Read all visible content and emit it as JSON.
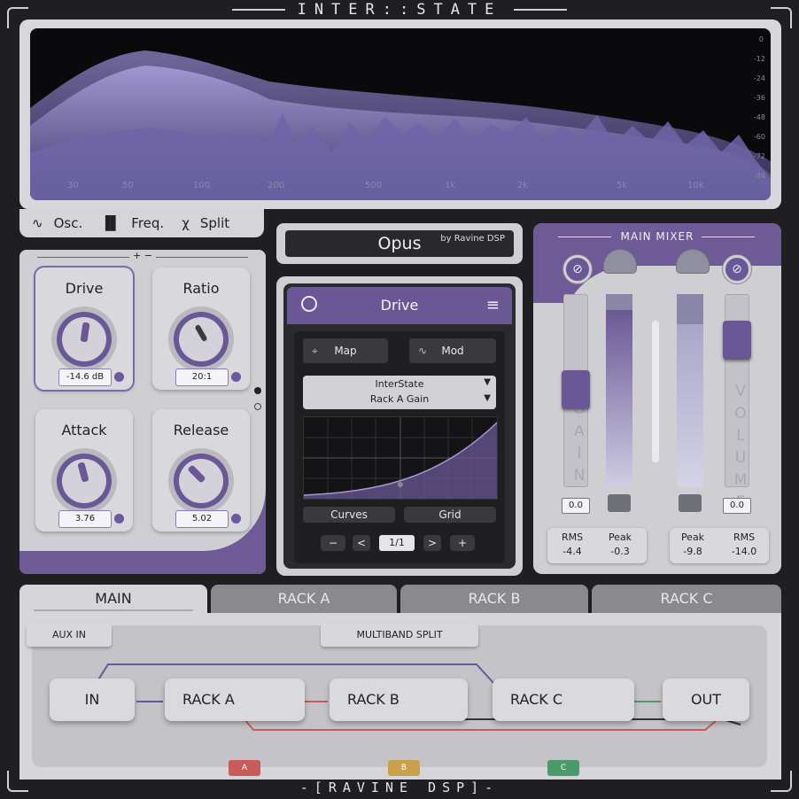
{
  "header": {
    "title": "INTER::STATE"
  },
  "footer": {
    "brand": "-[RAVINE DSP]-"
  },
  "spectrum": {
    "db_scale": [
      "0",
      "-12",
      "-24",
      "-36",
      "-48",
      "-60",
      "-72",
      "-84"
    ],
    "freq_scale": [
      "30",
      "50",
      "100",
      "200",
      "500",
      "1k",
      "2k",
      "5k",
      "10k"
    ]
  },
  "view_tabs": [
    {
      "icon": "oscilloscope-icon",
      "label": "Osc."
    },
    {
      "icon": "bars-icon",
      "label": "Freq."
    },
    {
      "icon": "split-icon",
      "label": "Split"
    }
  ],
  "compressor": {
    "plusminus": "+ −",
    "knobs": [
      {
        "label": "Drive",
        "value": "-14.6 dB"
      },
      {
        "label": "Ratio",
        "value": "20:1"
      },
      {
        "label": "Attack",
        "value": "3.76"
      },
      {
        "label": "Release",
        "value": "5.02"
      }
    ]
  },
  "plugin": {
    "name": "Opus",
    "vendor": "by Ravine DSP"
  },
  "drive_module": {
    "title": "Drive",
    "map_label": "Map",
    "mod_label": "Mod",
    "source": "InterState",
    "target": "Rack A Gain",
    "curves_label": "Curves",
    "grid_label": "Grid",
    "minus": "−",
    "prev": "<",
    "page": "1/1",
    "next": ">",
    "plus": "+"
  },
  "mixer": {
    "title": "MAIN MIXER",
    "gain_label": "GAIN",
    "volume_label": "VOLUME",
    "gain_value": "0.0",
    "volume_value": "0.0",
    "stats_left": [
      {
        "label": "RMS",
        "value": "-4.4"
      },
      {
        "label": "Peak",
        "value": "-0.3"
      }
    ],
    "stats_right": [
      {
        "label": "Peak",
        "value": "-9.8"
      },
      {
        "label": "RMS",
        "value": "-14.0"
      }
    ],
    "accent": "#6d5a97"
  },
  "routing": {
    "tabs": [
      "MAIN",
      "RACK A",
      "RACK B",
      "RACK C"
    ],
    "aux_in": "AUX IN",
    "multiband": "MULTIBAND SPLIT",
    "nodes": [
      "IN",
      "RACK A",
      "RACK B",
      "RACK C",
      "OUT"
    ],
    "chips": [
      {
        "label": "A",
        "color": "#c85a5a"
      },
      {
        "label": "B",
        "color": "#c9a14a"
      },
      {
        "label": "C",
        "color": "#4a9a6a"
      }
    ]
  }
}
